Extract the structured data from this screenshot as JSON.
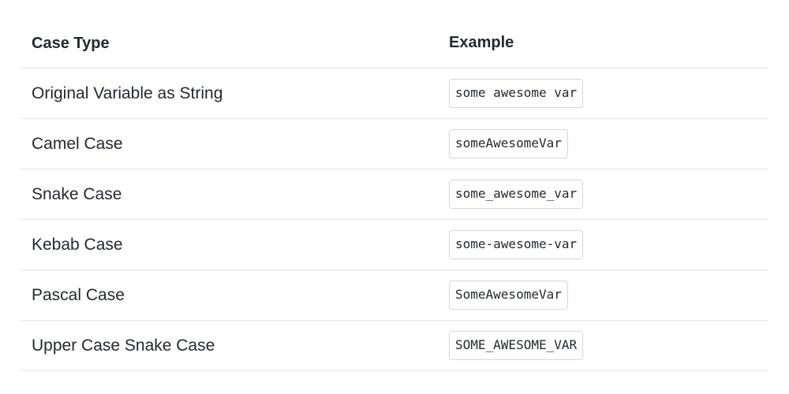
{
  "table": {
    "headers": {
      "case_type": "Case Type",
      "example": "Example"
    },
    "rows": [
      {
        "case_type": "Original Variable as String",
        "example": "some awesome var"
      },
      {
        "case_type": "Camel Case",
        "example": "someAwesomeVar"
      },
      {
        "case_type": "Snake Case",
        "example": "some_awesome_var"
      },
      {
        "case_type": "Kebab Case",
        "example": "some-awesome-var"
      },
      {
        "case_type": "Pascal Case",
        "example": "SomeAwesomeVar"
      },
      {
        "case_type": "Upper Case Snake Case",
        "example": "SOME_AWESOME_VAR"
      }
    ]
  }
}
